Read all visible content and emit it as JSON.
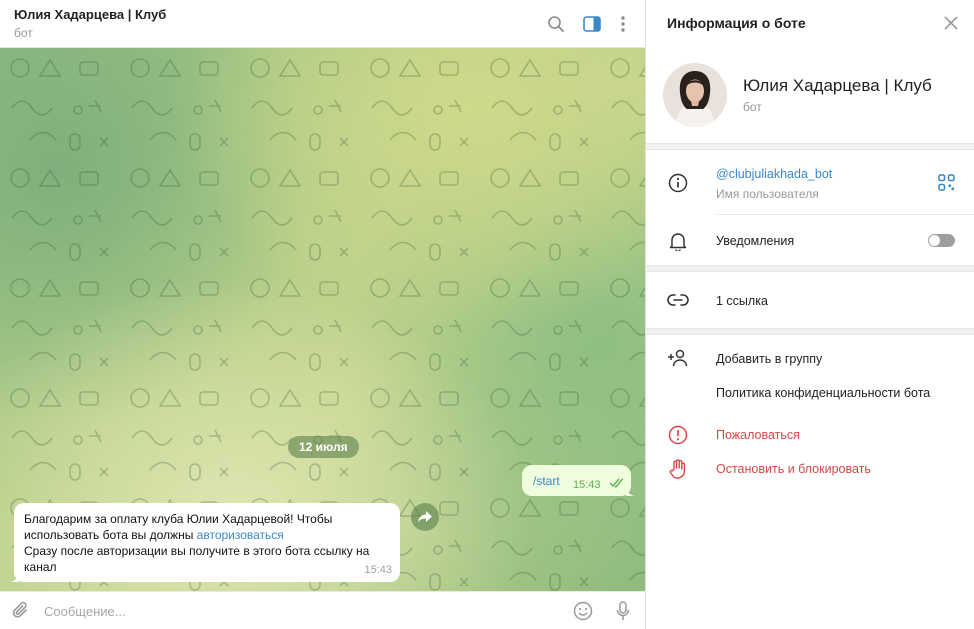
{
  "chat": {
    "title": "Юлия Хадарцева | Клуб",
    "subtitle": "бот",
    "icons": {
      "search": "search-icon",
      "sidebar": "sidebar-toggle-icon",
      "more": "more-vertical-icon"
    },
    "date_separator": "12 июля",
    "outgoing": {
      "text": "/start",
      "time": "15:43",
      "status": "read-double-check"
    },
    "incoming": {
      "line1": "Благодарим за оплату клуба Юлии Хадарцевой! Чтобы",
      "line2": "использовать бота вы должны",
      "link": "авторизоваться",
      "line3": "Сразу после авторизации вы получите в этого бота ссылку на",
      "line4": "канал",
      "time": "15:43"
    },
    "composer": {
      "placeholder": "Сообщение..."
    }
  },
  "info": {
    "title": "Информация о боте",
    "name": "Юлия Хадарцева | Клуб",
    "subtitle": "бот",
    "username": "@clubjuliakhada_bot",
    "username_label": "Имя пользователя",
    "notifications_label": "Уведомления",
    "notifications_on": false,
    "links_label": "1 ссылка",
    "add_to_group": "Добавить в группу",
    "privacy_policy": "Политика конфиденциальности бота",
    "report": "Пожаловаться",
    "stop_block": "Остановить и блокировать"
  },
  "colors": {
    "accent": "#3a88c9",
    "danger": "#d6474a",
    "outgoing_bubble": "#effdde",
    "read_check": "#5fb04e"
  }
}
